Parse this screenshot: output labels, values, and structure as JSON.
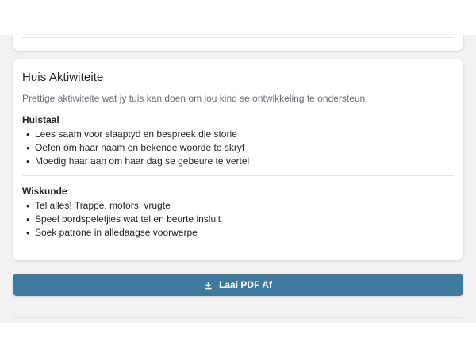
{
  "activities_card": {
    "title": "Huis Aktiwiteite",
    "description": "Prettige aktiwiteite wat jy tuis kan doen om jou kind se ontwikkeling te ondersteun.",
    "sections": [
      {
        "title": "Huistaal",
        "items": [
          "Lees saam voor slaaptyd en bespreek die storie",
          "Oefen om haar naam en bekende woorde te skryf",
          "Moedig haar aan om haar dag se gebeure te vertel"
        ]
      },
      {
        "title": "Wiskunde",
        "items": [
          "Tel alles! Trappe, motors, vrugte",
          "Speel bordspeletjies wat tel en beurte insluit",
          "Soek patrone in alledaagse voorwerpe"
        ]
      }
    ]
  },
  "download_button": {
    "label": "Laai PDF Af",
    "icon": "download-icon"
  },
  "colors": {
    "accent": "#3d7a9e",
    "background": "#f2f2f3"
  }
}
